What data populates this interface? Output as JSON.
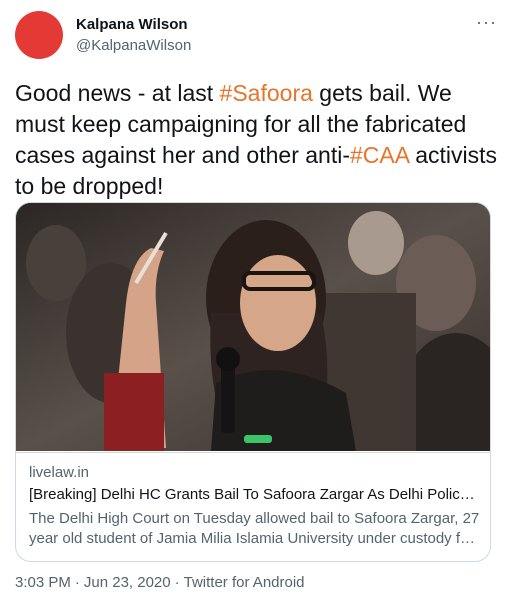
{
  "author": {
    "name": "Kalpana Wilson",
    "handle": "@KalpanaWilson"
  },
  "more_icon": "ellipsis-icon",
  "tweet": {
    "text_1": "Good news - at last ",
    "hashtag_1": "#Safoora",
    "text_2": " gets bail. We must keep campaigning for all the fabricated cases against her and other anti-",
    "hashtag_2": "#CAA",
    "text_3": " activists to be dropped!"
  },
  "card": {
    "domain": "livelaw.in",
    "title": "[Breaking] Delhi HC Grants Bail To Safoora Zargar As Delhi Police…",
    "description": "The Delhi High Court on Tuesday allowed bail to Safoora Zargar, 27 year old student of Jamia Milia Islamia University under custody f…"
  },
  "footer": {
    "time": "3:03 PM",
    "separator": "·",
    "date": "Jun 23, 2020",
    "source": "Twitter for Android"
  },
  "colors": {
    "hashtag": "#e8742a",
    "avatar": "#e33a36",
    "secondary_text": "#536471",
    "border": "#cfd9de"
  }
}
